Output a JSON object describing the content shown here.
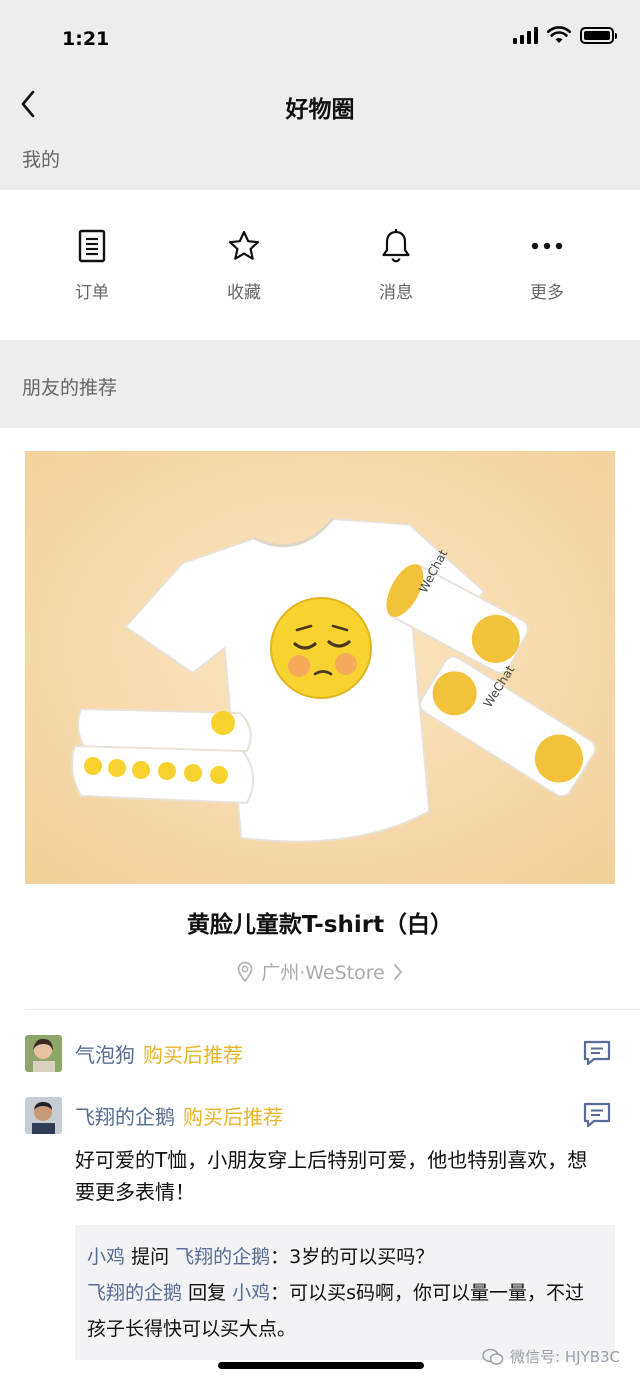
{
  "status_bar": {
    "time": "1:21"
  },
  "nav": {
    "title": "好物圈",
    "back_icon": "chevron-left-icon"
  },
  "my_section": {
    "label": "我的",
    "actions": [
      {
        "label": "订单",
        "icon": "order-list-icon"
      },
      {
        "label": "收藏",
        "icon": "star-icon"
      },
      {
        "label": "消息",
        "icon": "bell-icon"
      },
      {
        "label": "更多",
        "icon": "more-dots-icon"
      }
    ]
  },
  "friends_section": {
    "label": "朋友的推荐"
  },
  "product": {
    "title": "黄脸儿童款T-shirt（白）",
    "location": "广州·WeStore",
    "image_colors": {
      "background": "#f6d9aa",
      "tshirt": "#ffffff",
      "emoji": "#f8d22e"
    }
  },
  "recommendations": [
    {
      "name": "气泡狗",
      "tag": "购买后推荐"
    },
    {
      "name": "飞翔的企鹅",
      "tag": "购买后推荐",
      "text": "好可爱的T恤，小朋友穿上后特别可爱，他也特别喜欢，想要更多表情！"
    }
  ],
  "replies": [
    {
      "user": "小鸡",
      "verb": "提问",
      "target": "飞翔的企鹅",
      "text": "：3岁的可以买吗？"
    },
    {
      "user": "飞翔的企鹅",
      "verb": "回复",
      "target": "小鸡",
      "text": "：可以买s码啊，你可以量一量，不过孩子长得快可以买大点。"
    }
  ],
  "watermark": {
    "text": "微信号: HJYB3C"
  },
  "colors": {
    "link": "#576b95",
    "tag": "#e8b52a",
    "background": "#ededed"
  }
}
